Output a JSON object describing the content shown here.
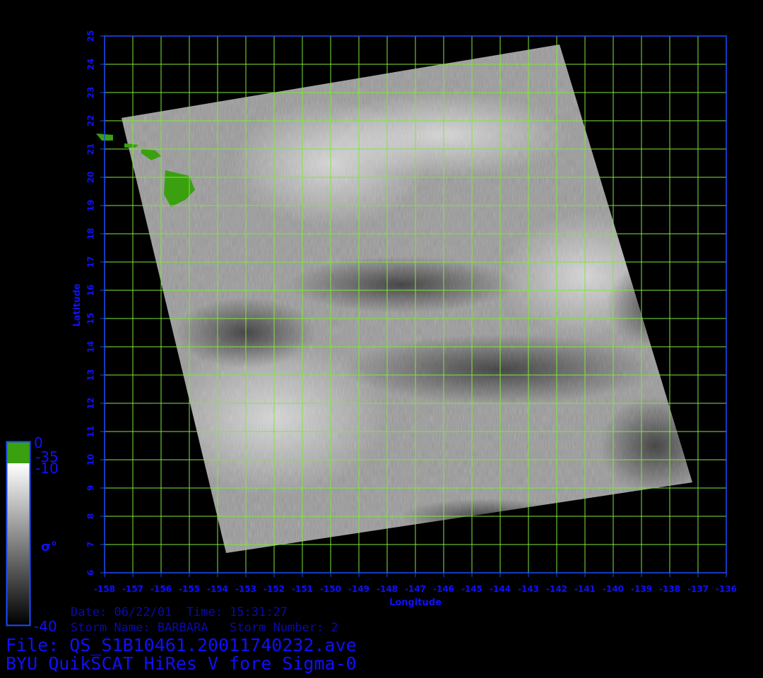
{
  "map": {
    "lon_min": -158,
    "lon_max": -136,
    "lat_min": 6,
    "lat_max": 25,
    "x_ticks": [
      "-158",
      "-157",
      "-156",
      "-155",
      "-154",
      "-153",
      "-152",
      "-151",
      "-150",
      "-149",
      "-148",
      "-147",
      "-146",
      "-145",
      "-144",
      "-143",
      "-142",
      "-141",
      "-140",
      "-139",
      "-138",
      "-137",
      "-136"
    ],
    "y_ticks": [
      "6",
      "7",
      "8",
      "9",
      "10",
      "11",
      "12",
      "13",
      "14",
      "15",
      "16",
      "17",
      "18",
      "19",
      "20",
      "21",
      "22",
      "23",
      "24",
      "25"
    ],
    "xlabel": "Longitude",
    "ylabel": "Latitude",
    "grid": true,
    "grid_color": "#7ee83a",
    "frame_color": "#1b4dff",
    "label_color": "#1010ff",
    "land_color": "#3aa010",
    "swath_corners_lonlat": [
      [
        -157.4,
        22.1
      ],
      [
        -141.9,
        24.7
      ],
      [
        -137.2,
        9.2
      ],
      [
        -153.7,
        6.7
      ]
    ]
  },
  "colorbar": {
    "labels": {
      "land_top": "0",
      "land_bottom": "-35",
      "top": "-10",
      "bottom": "-40",
      "symbol": "σ°"
    },
    "scale_colors": [
      "#ffffff",
      "#000000"
    ],
    "land_color": "#3aa010"
  },
  "info": {
    "date_time": "Date: 06/22/01  Time: 15:31:27",
    "storm": "Storm Name: BARBARA   Storm Number: 2",
    "file": "File: QS_S1B10461.20011740232.ave",
    "title": "BYU QuikSCAT HiRes V fore Sigma-0"
  }
}
